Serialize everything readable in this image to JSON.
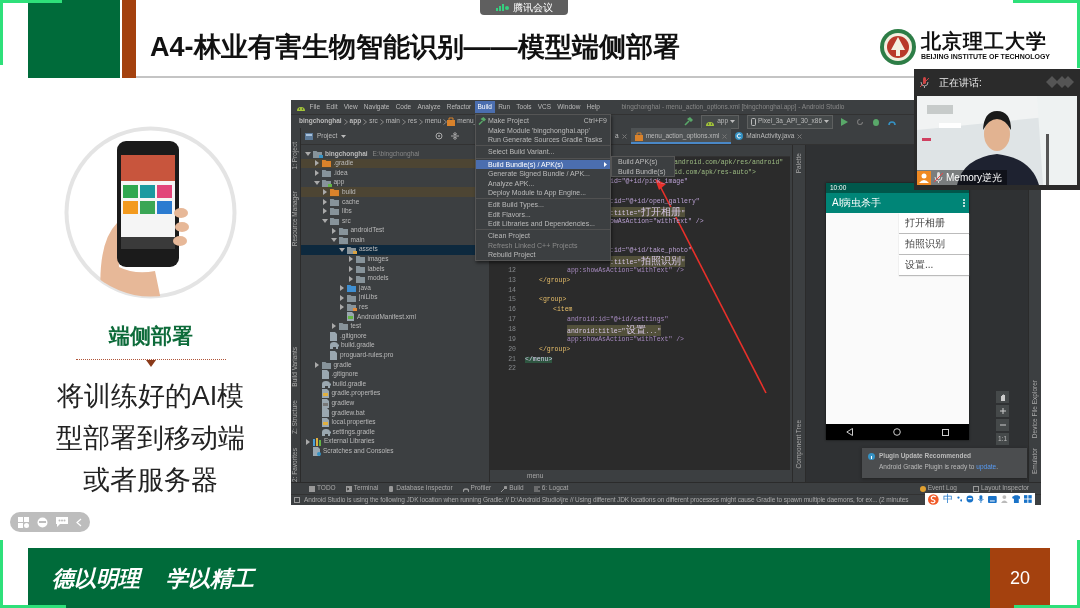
{
  "meeting_bar": {
    "app_name": "腾讯会议"
  },
  "slide": {
    "title": "A4-林业有害生物智能识别——模型端侧部署",
    "university_name": "北京理工大学",
    "university_name_en": "BEIJING INSTITUTE OF TECHNOLOGY",
    "section_heading": "端侧部署",
    "body_text": "将训练好的AI模型部署到移动端或者服务器",
    "motto": [
      "德以明理",
      "学以精工"
    ],
    "page_number": "20"
  },
  "ide": {
    "menu_bar": [
      {
        "label": "File",
        "selected": false
      },
      {
        "label": "Edit",
        "selected": false
      },
      {
        "label": "View",
        "selected": false
      },
      {
        "label": "Navigate",
        "selected": false
      },
      {
        "label": "Code",
        "selected": false
      },
      {
        "label": "Analyze",
        "selected": false
      },
      {
        "label": "Refactor",
        "selected": false
      },
      {
        "label": "Build",
        "selected": true
      },
      {
        "label": "Run",
        "selected": false
      },
      {
        "label": "Tools",
        "selected": false
      },
      {
        "label": "VCS",
        "selected": false
      },
      {
        "label": "Window",
        "selected": false
      },
      {
        "label": "Help",
        "selected": false
      }
    ],
    "window_title": "bingchonghai - menu_action_options.xml [bingchonghai.app] - Android Studio",
    "breadcrumb": [
      {
        "label": "bingchonghai",
        "kind": "module"
      },
      {
        "label": "app",
        "kind": "module"
      },
      {
        "label": "src",
        "kind": "folder"
      },
      {
        "label": "main",
        "kind": "folder"
      },
      {
        "label": "res",
        "kind": "folder"
      },
      {
        "label": "menu",
        "kind": "folder"
      },
      {
        "label": "menu_",
        "kind": "file"
      }
    ],
    "run_config": "app",
    "device": "Pixel_3a_API_30_x86",
    "left_tool_tabs": [
      "1: Project",
      "Resource Manager",
      "Build Variants",
      "Z: Structure",
      "2: Favorites"
    ],
    "project_panel": {
      "title": "Project",
      "tree": [
        {
          "label": "bingchonghai",
          "path": "E:\\bingchonghai",
          "kind": "project",
          "expanded": true,
          "selected": false,
          "children": [
            {
              "label": ".gradle",
              "kind": "excluded",
              "expanded": false,
              "selected": false
            },
            {
              "label": ".idea",
              "kind": "folder",
              "expanded": false,
              "selected": false
            },
            {
              "label": "app",
              "kind": "module",
              "expanded": true,
              "selected": false,
              "children": [
                {
                  "label": "build",
                  "kind": "excluded",
                  "expanded": false,
                  "selected": false
                },
                {
                  "label": "cache",
                  "kind": "folder",
                  "expanded": false,
                  "selected": false
                },
                {
                  "label": "libs",
                  "kind": "folder",
                  "expanded": false,
                  "selected": false
                },
                {
                  "label": "src",
                  "kind": "folder",
                  "expanded": true,
                  "selected": false,
                  "children": [
                    {
                      "label": "androidTest",
                      "kind": "folder",
                      "expanded": false,
                      "selected": false
                    },
                    {
                      "label": "main",
                      "kind": "folder",
                      "expanded": true,
                      "selected": false,
                      "children": [
                        {
                          "label": "assets",
                          "kind": "assets",
                          "expanded": true,
                          "selected": true,
                          "children": [
                            {
                              "label": "images",
                              "kind": "folder",
                              "expanded": false,
                              "selected": false
                            },
                            {
                              "label": "labels",
                              "kind": "folder",
                              "expanded": false,
                              "selected": false
                            },
                            {
                              "label": "models",
                              "kind": "folder",
                              "expanded": false,
                              "selected": false
                            }
                          ]
                        },
                        {
                          "label": "java",
                          "kind": "source",
                          "expanded": false,
                          "selected": false
                        },
                        {
                          "label": "jniLibs",
                          "kind": "folder",
                          "expanded": false,
                          "selected": false
                        },
                        {
                          "label": "res",
                          "kind": "resource",
                          "expanded": false,
                          "selected": false
                        },
                        {
                          "label": "AndroidManifest.xml",
                          "kind": "xml-file",
                          "expanded": false,
                          "selected": false
                        }
                      ]
                    },
                    {
                      "label": "test",
                      "kind": "folder",
                      "expanded": false,
                      "selected": false
                    }
                  ]
                },
                {
                  "label": ".gitignore",
                  "kind": "ignore-file",
                  "expanded": false,
                  "selected": false
                },
                {
                  "label": "build.gradle",
                  "kind": "gradle-file",
                  "expanded": false,
                  "selected": false
                },
                {
                  "label": "proguard-rules.pro",
                  "kind": "text-file",
                  "expanded": false,
                  "selected": false
                }
              ]
            },
            {
              "label": "gradle",
              "kind": "folder",
              "expanded": false,
              "selected": false
            },
            {
              "label": ".gitignore",
              "kind": "ignore-file",
              "expanded": false,
              "selected": false
            },
            {
              "label": "build.gradle",
              "kind": "gradle-file",
              "expanded": false,
              "selected": false
            },
            {
              "label": "gradle.properties",
              "kind": "properties-file",
              "expanded": false,
              "selected": false
            },
            {
              "label": "gradlew",
              "kind": "script-file",
              "expanded": false,
              "selected": false
            },
            {
              "label": "gradlew.bat",
              "kind": "text-file",
              "expanded": false,
              "selected": false
            },
            {
              "label": "local.properties",
              "kind": "properties-file",
              "expanded": false,
              "selected": false
            },
            {
              "label": "settings.gradle",
              "kind": "gradle-file",
              "expanded": false,
              "selected": false
            }
          ]
        },
        {
          "label": "External Libraries",
          "kind": "library",
          "expanded": false,
          "selected": false
        },
        {
          "label": "Scratches and Consoles",
          "kind": "scratch",
          "expanded": false,
          "selected": false
        }
      ]
    },
    "editor_tabs": [
      {
        "label": "a",
        "kind": "plain",
        "selected": false
      },
      {
        "label": "menu_action_options.xml",
        "kind": "xml",
        "selected": true
      },
      {
        "label": "MainActivity.java",
        "kind": "java",
        "selected": false
      }
    ],
    "code_lines": [
      {
        "kind": "cut-submenu",
        "text": "android.com/apk/res/android\"",
        "highlighted": false
      },
      {
        "kind": "cut-submenu",
        "text": "id.com/apk/res-auto\">",
        "highlighted": false
      },
      {
        "kind": "cut-menu",
        "text": "id=\"@+id/pick_image\"",
        "highlighted": false
      },
      {
        "kind": "blank"
      },
      {
        "kind": "cut-menu",
        "text": ":id=\"@+id/open_gallery\"",
        "highlighted": false
      },
      {
        "kind": "cut-menu",
        "text": ":title=\"打开相册\"",
        "highlighted": true
      },
      {
        "kind": "cut-menu",
        "text": "owAsAction=\"withText\" />",
        "highlighted": false
      },
      {
        "kind": "blank"
      },
      {
        "kind": "blank"
      },
      {
        "kind": "cut-menu",
        "text": ":id=\"@+id/take_photo\"",
        "highlighted": false
      },
      {
        "kind": "cut-menu",
        "text": ":title=\"拍照识别\"",
        "highlighted": true
      },
      {
        "kind": "attr",
        "number": "12",
        "text": "app:showAsAction=\"withText\" />",
        "highlighted": false
      },
      {
        "kind": "group",
        "number": "13",
        "text": "</group>",
        "highlighted": false
      },
      {
        "kind": "empty",
        "number": "14"
      },
      {
        "kind": "group",
        "number": "15",
        "text": "<group>",
        "highlighted": false
      },
      {
        "kind": "item",
        "number": "16",
        "text": "<item",
        "highlighted": false
      },
      {
        "kind": "attr",
        "number": "17",
        "text": "android:id=\"@+id/settings\"",
        "highlighted": false
      },
      {
        "kind": "attr",
        "number": "18",
        "text": "android:title=\"设置...\"",
        "highlighted": true
      },
      {
        "kind": "attr",
        "number": "19",
        "text": "app:showAsAction=\"withText\" />",
        "highlighted": false
      },
      {
        "kind": "group",
        "number": "20",
        "text": "</group>",
        "highlighted": false
      },
      {
        "kind": "root",
        "number": "21",
        "text": "</menu>",
        "highlighted": true
      },
      {
        "kind": "empty",
        "number": "22"
      }
    ],
    "editor_breadcrumb": "menu",
    "palette_tabs": [
      "Palette",
      "Component Tree"
    ],
    "preview": {
      "time": "10:00",
      "app_title": "AI病虫杀手",
      "menu_items": [
        "打开相册",
        "拍照识别",
        "设置..."
      ],
      "zoom_reset": "1:1"
    },
    "right_tool_tabs": [
      "Device File Explorer",
      "Emulator"
    ],
    "notification": {
      "title": "Plugin Update Recommended",
      "text": "Android Gradle Plugin is ready to",
      "link": "update",
      "text_end": "."
    },
    "tool_tabs": [
      "TODO",
      "Terminal",
      "Database Inspector",
      "Profiler",
      "Build",
      "6: Logcat"
    ],
    "right_bottom_tabs": [
      "Event Log",
      "Layout Inspector"
    ],
    "status_text": "Android Studio is using the following JDK location when running Gradle: // D:\\Android Studio\\jre // Using different JDK locations on different processes might cause Gradle to spawn multiple daemons, for ex... (2 minutes",
    "build_menu": [
      {
        "kind": "tool",
        "label": "Make Project",
        "shortcut": "Ctrl+F9",
        "selected": false,
        "disabled": false
      },
      {
        "kind": "item",
        "label": "Make Module 'bingchonghai.app'",
        "selected": false,
        "disabled": false
      },
      {
        "kind": "item",
        "label": "Run Generate Sources Gradle Tasks",
        "selected": false,
        "disabled": false
      },
      {
        "kind": "separator"
      },
      {
        "kind": "item",
        "label": "Select Build Variant...",
        "selected": false,
        "disabled": false
      },
      {
        "kind": "separator"
      },
      {
        "kind": "submenu",
        "label": "Build Bundle(s) / APK(s)",
        "selected": true,
        "disabled": false
      },
      {
        "kind": "item",
        "label": "Generate Signed Bundle / APK...",
        "selected": false,
        "disabled": false
      },
      {
        "kind": "item",
        "label": "Analyze APK...",
        "selected": false,
        "disabled": false
      },
      {
        "kind": "item",
        "label": "Deploy Module to App Engine...",
        "selected": false,
        "disabled": false
      },
      {
        "kind": "separator"
      },
      {
        "kind": "item",
        "label": "Edit Build Types...",
        "selected": false,
        "disabled": false
      },
      {
        "kind": "item",
        "label": "Edit Flavors...",
        "selected": false,
        "disabled": false
      },
      {
        "kind": "item",
        "label": "Edit Libraries and Dependencies...",
        "selected": false,
        "disabled": false
      },
      {
        "kind": "separator"
      },
      {
        "kind": "item",
        "label": "Clean Project",
        "selected": false,
        "disabled": false
      },
      {
        "kind": "item",
        "label": "Refresh Linked C++ Projects",
        "selected": false,
        "disabled": true
      },
      {
        "kind": "item",
        "label": "Rebuild Project",
        "selected": false,
        "disabled": false
      }
    ],
    "build_submenu": [
      {
        "label": "Build APK(s)",
        "selected": false
      },
      {
        "label": "Build Bundle(s)",
        "selected": false
      }
    ]
  },
  "input_method": {
    "mode": "中"
  },
  "speaker_window": {
    "heading": "正在讲话:",
    "name": "Memory逆光"
  }
}
